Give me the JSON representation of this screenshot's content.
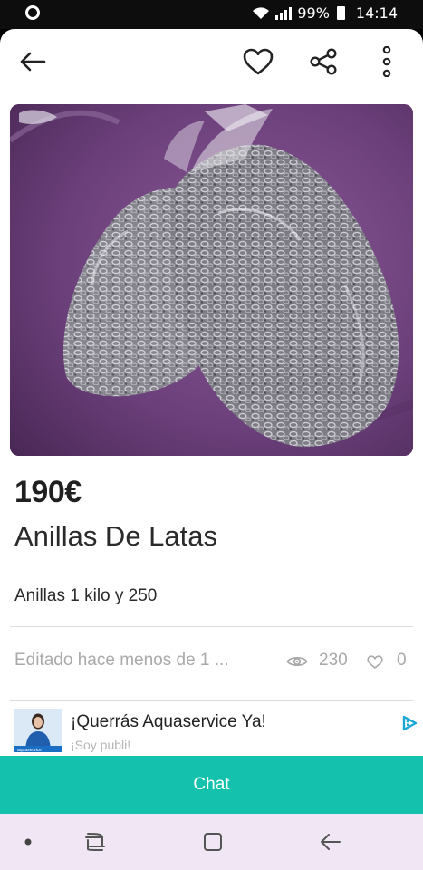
{
  "status_bar": {
    "battery": "99%",
    "time": "14:14"
  },
  "toolbar": {
    "back_icon": "arrow-left-icon",
    "favorite_icon": "heart-icon",
    "share_icon": "share-icon",
    "more_icon": "more-vertical-icon"
  },
  "product": {
    "price": "190€",
    "title": "Anillas De Latas",
    "description": "Anillas 1 kilo y 250",
    "edited": "Editado hace menos de 1 ...",
    "views": "230",
    "likes": "0"
  },
  "ad": {
    "title": "¡Querrás Aquaservice Ya!",
    "subtitle": "¡Soy publi!",
    "brand_logo": "aquaservice"
  },
  "chat": {
    "label": "Chat"
  },
  "colors": {
    "accent": "#13c1ac",
    "nav_background": "#f1e6f3"
  },
  "navigation": {
    "dot_icon": "dot-icon",
    "recents_icon": "recents-icon",
    "home_icon": "home-icon",
    "back_icon": "back-icon"
  }
}
